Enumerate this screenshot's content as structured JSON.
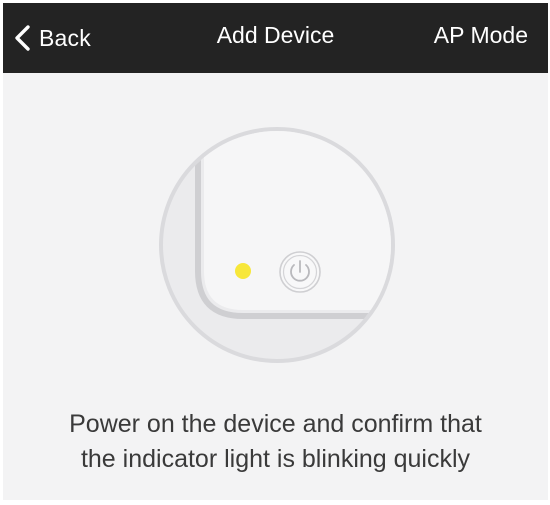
{
  "navbar": {
    "back_label": "Back",
    "title": "Add Device",
    "right_action_label": "AP Mode"
  },
  "illustration": {
    "indicator_light_color": "#f7e73a",
    "device_icon": "power-icon"
  },
  "instruction": {
    "line1": "Power on the device and confirm that",
    "line2": "the indicator light is blinking quickly"
  },
  "colors": {
    "navbar_bg": "#232323",
    "page_bg": "#f3f3f4",
    "text": "#3a3a3a"
  }
}
